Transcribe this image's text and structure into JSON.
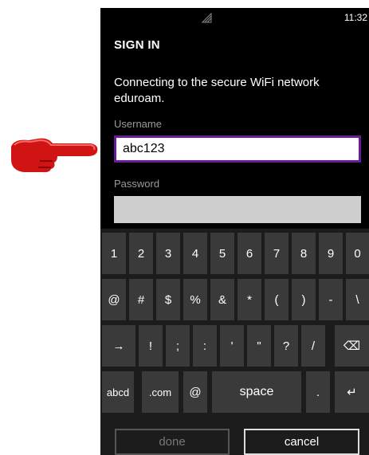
{
  "status_bar": {
    "time": "11:32",
    "signal_icon": "wifi-signal-icon"
  },
  "screen": {
    "title": "SIGN IN",
    "message": "Connecting to the secure WiFi network eduroam.",
    "username_label": "Username",
    "username_value": "abc123",
    "password_label": "Password",
    "password_value": ""
  },
  "pointer": {
    "icon": "pointing-hand-icon",
    "color": "#d01414"
  },
  "keyboard": {
    "rows": [
      [
        "1",
        "2",
        "3",
        "4",
        "5",
        "6",
        "7",
        "8",
        "9",
        "0"
      ],
      [
        "@",
        "#",
        "$",
        "%",
        "&",
        "*",
        "(",
        ")",
        "-",
        "\\"
      ],
      [
        "→",
        "!",
        ";",
        ":",
        "'",
        "\"",
        "?",
        "/",
        "⌫"
      ],
      [
        "abcd",
        ".com",
        "@",
        "space",
        ".",
        "↵"
      ]
    ],
    "icons": {
      "tab": "arrow-right-icon",
      "backspace": "backspace-icon",
      "enter": "enter-icon"
    }
  },
  "buttons": {
    "done": "done",
    "cancel": "cancel"
  },
  "colors": {
    "focus_border": "#6a1b9a",
    "screen_bg": "#000000",
    "key_bg": "#3a3a3a"
  }
}
